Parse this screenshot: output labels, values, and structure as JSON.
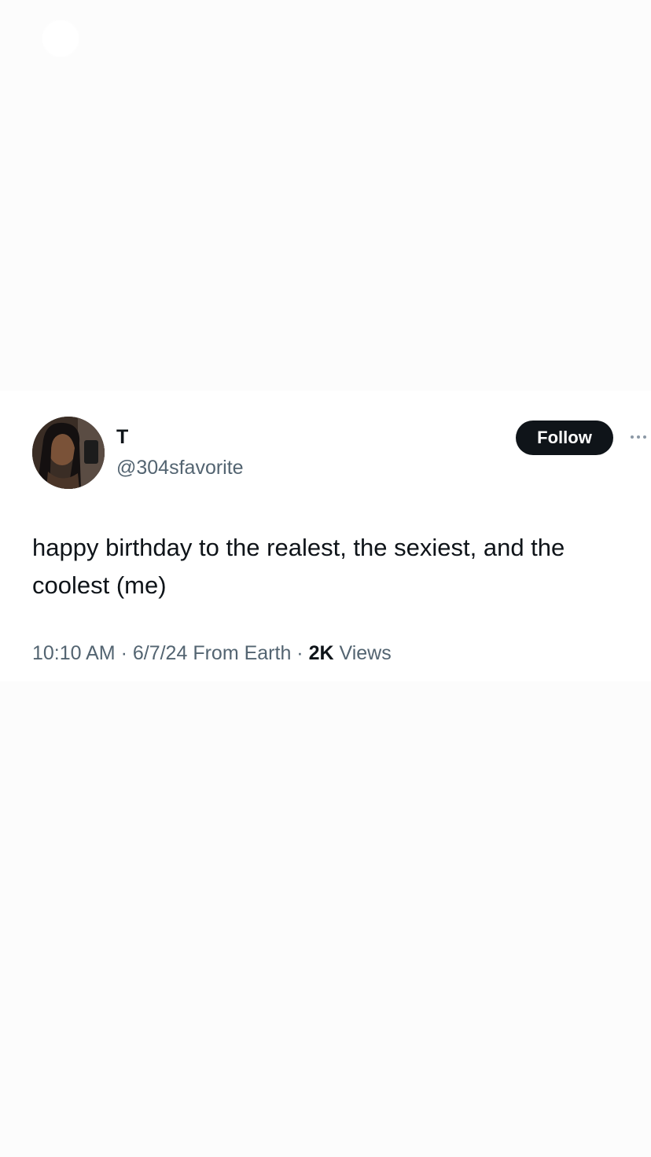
{
  "tweet": {
    "author_name": "T",
    "author_handle": "@304sfavorite",
    "follow_label": "Follow",
    "more_icon": "more-horizontal-icon",
    "text": "happy birthday to the realest, the sexiest, and the coolest (me)",
    "time": "10:10 AM",
    "separator": " · ",
    "date": "6/7/24",
    "location": " From Earth",
    "views_count": "2K",
    "views_label": " Views"
  },
  "colors": {
    "background": "#fcfcfc",
    "card": "#ffffff",
    "follow_bg": "#0f1419",
    "secondary_text": "#536471"
  }
}
